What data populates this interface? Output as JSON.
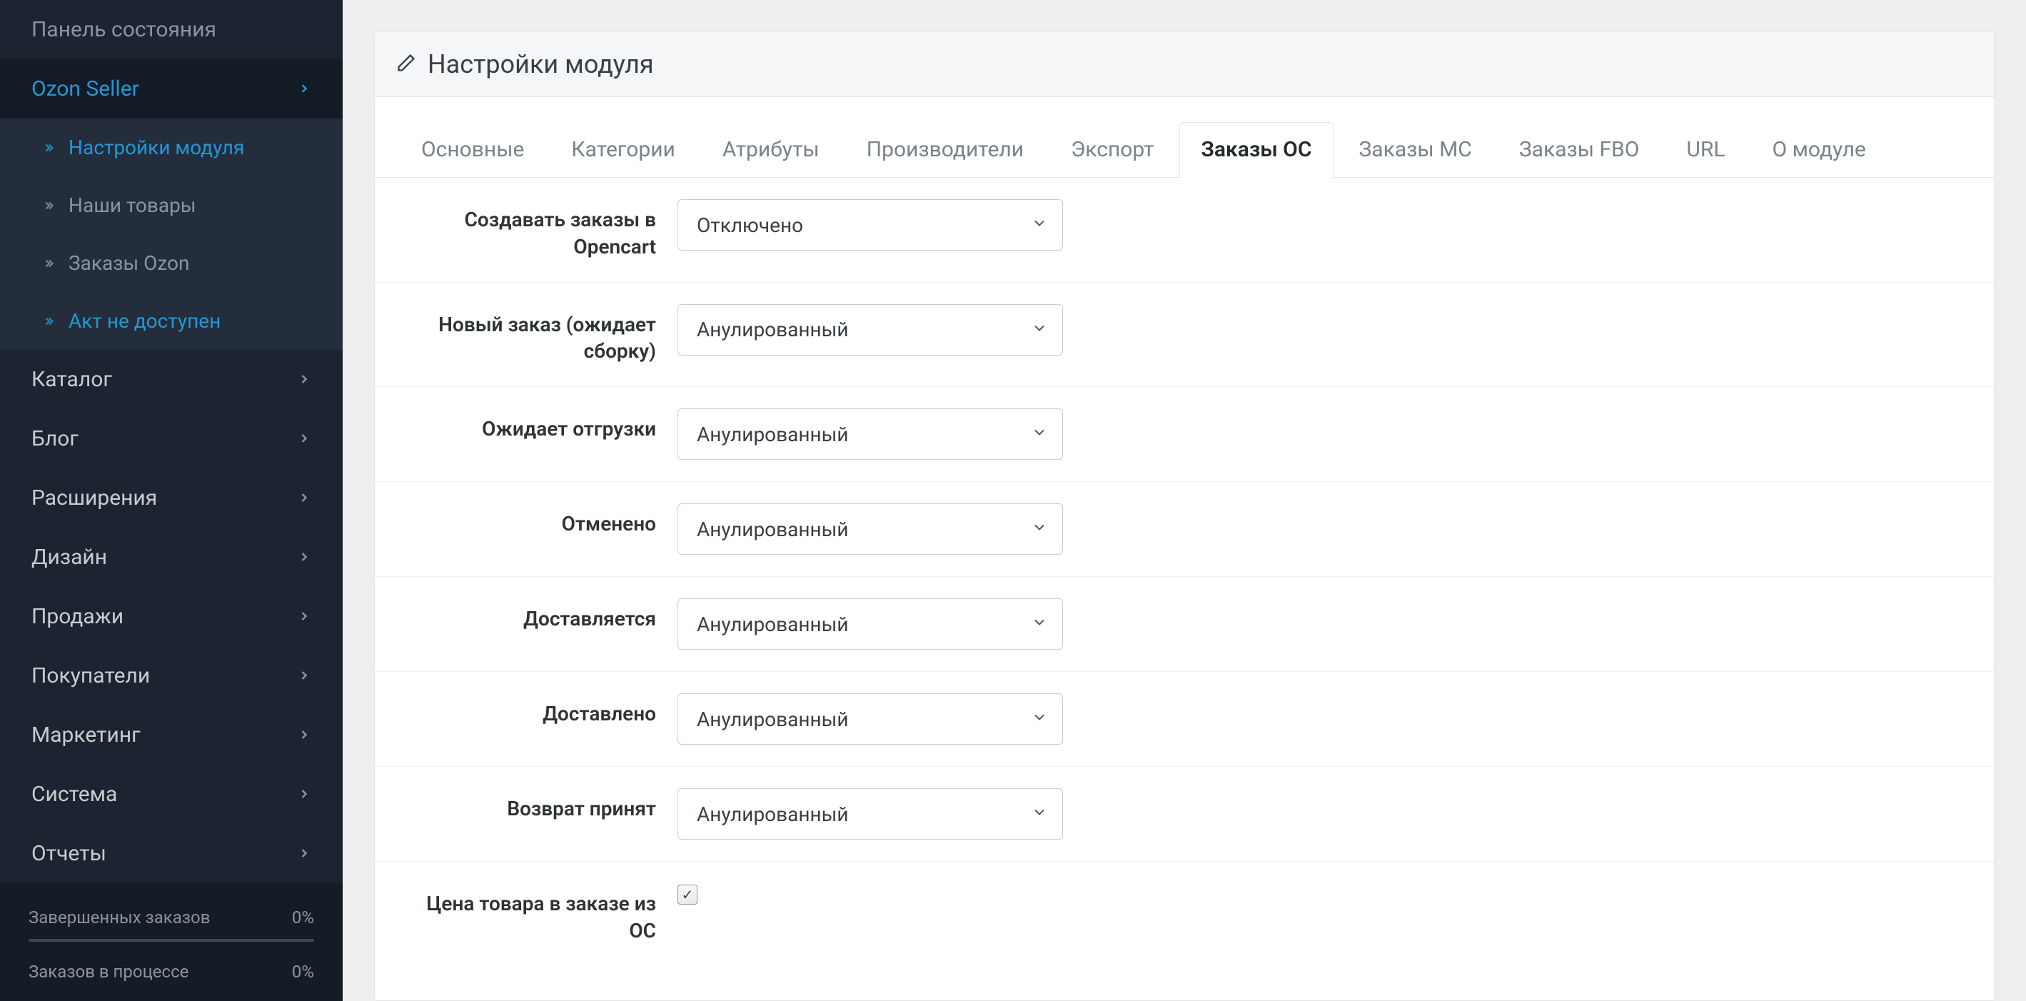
{
  "sidebar": {
    "section_title": "Панель состояния",
    "active_item": "Ozon Seller",
    "sub_items": [
      {
        "label": "Настройки модуля",
        "active": true
      },
      {
        "label": "Наши товары",
        "active": false
      },
      {
        "label": "Заказы Ozon",
        "active": false
      },
      {
        "label": "Акт не доступен",
        "active": true
      }
    ],
    "nav": [
      "Каталог",
      "Блог",
      "Расширения",
      "Дизайн",
      "Продажи",
      "Покупатели",
      "Маркетинг",
      "Система",
      "Отчеты"
    ],
    "footer": {
      "rows": [
        {
          "label": "Завершенных заказов",
          "value": "0%"
        },
        {
          "label": "Заказов в процессе",
          "value": "0%"
        }
      ]
    }
  },
  "panel": {
    "title": "Настройки модуля"
  },
  "tabs": [
    "Основные",
    "Категории",
    "Атрибуты",
    "Производители",
    "Экспорт",
    "Заказы ОС",
    "Заказы МС",
    "Заказы FBO",
    "URL",
    "О модуле"
  ],
  "active_tab": "Заказы ОС",
  "form": {
    "rows": [
      {
        "label": "Создавать заказы в Opencart",
        "value": "Отключено"
      },
      {
        "label": "Новый заказ (ожидает сборку)",
        "value": "Анулированный"
      },
      {
        "label": "Ожидает отгрузки",
        "value": "Анулированный"
      },
      {
        "label": "Отменено",
        "value": "Анулированный"
      },
      {
        "label": "Доставляется",
        "value": "Анулированный"
      },
      {
        "label": "Доставлено",
        "value": "Анулированный"
      },
      {
        "label": "Возврат принят",
        "value": "Анулированный"
      }
    ],
    "checkbox_row": {
      "label": "Цена товара в заказе из ОС",
      "checked": true
    }
  }
}
